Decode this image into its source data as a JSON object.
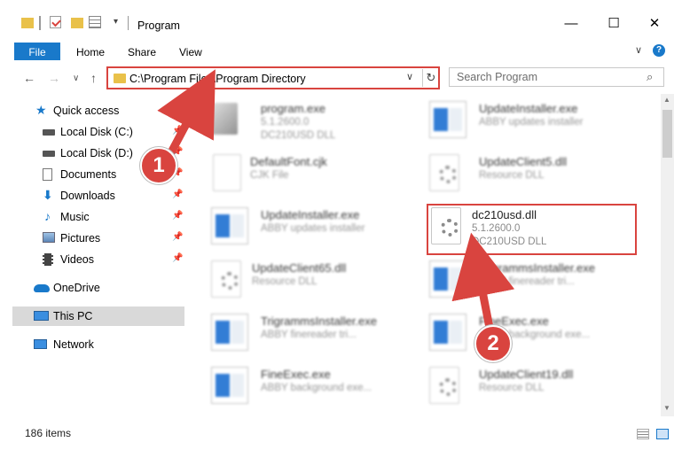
{
  "window": {
    "title": "Program",
    "controls": {
      "minimize": "—",
      "maximize": "☐",
      "close": "✕"
    }
  },
  "ribbon": {
    "file": "File",
    "home": "Home",
    "share": "Share",
    "view": "View",
    "collapse": "∨",
    "help": "?"
  },
  "address": {
    "path": "C:\\Program Files\\Program Directory",
    "dropdown": "∨",
    "refresh": "↻"
  },
  "search": {
    "placeholder": "Search Program"
  },
  "nav": {
    "back": "←",
    "forward": "→",
    "recent": "∨",
    "up": "↑",
    "items": [
      {
        "label": "Quick access",
        "icon": "star-icon",
        "pinned": false
      },
      {
        "label": "Local Disk (C:)",
        "icon": "drive-icon",
        "pinned": true
      },
      {
        "label": "Local Disk (D:)",
        "icon": "drive-icon",
        "pinned": true
      },
      {
        "label": "Documents",
        "icon": "documents-icon",
        "pinned": true
      },
      {
        "label": "Downloads",
        "icon": "download-icon",
        "pinned": true
      },
      {
        "label": "Music",
        "icon": "music-icon",
        "pinned": true
      },
      {
        "label": "Pictures",
        "icon": "pictures-icon",
        "pinned": true
      },
      {
        "label": "Videos",
        "icon": "videos-icon",
        "pinned": true
      },
      {
        "label": "OneDrive",
        "icon": "cloud-icon"
      },
      {
        "label": "This PC",
        "icon": "computer-icon"
      },
      {
        "label": "Network",
        "icon": "network-icon"
      }
    ]
  },
  "files": [
    {
      "name": "program.exe",
      "line1": "5.1.2600.0",
      "line2": "DC210USD DLL",
      "type": "exe"
    },
    {
      "name": "UpdateInstaller.exe",
      "line1": "ABBY updates installer",
      "line2": "",
      "type": "app"
    },
    {
      "name": "DefaultFont.cjk",
      "line1": "CJK File",
      "line2": "",
      "type": "doc"
    },
    {
      "name": "UpdateClient5.dll",
      "line1": "Resource DLL",
      "line2": "",
      "type": "dll"
    },
    {
      "name": "UpdateInstaller.exe",
      "line1": "ABBY updates installer",
      "line2": "",
      "type": "app"
    },
    {
      "name": "dc210usd.dll",
      "line1": "5.1.2600.0",
      "line2": "DC210USD DLL",
      "type": "dll"
    },
    {
      "name": "UpdateClient65.dll",
      "line1": "Resource DLL",
      "line2": "",
      "type": "dll"
    },
    {
      "name": "TrigrammsInstaller.exe",
      "line1": "ABBY finereader tri...",
      "line2": "",
      "type": "app"
    },
    {
      "name": "TrigrammsInstaller.exe",
      "line1": "ABBY finereader tri...",
      "line2": "",
      "type": "app"
    },
    {
      "name": "FineExec.exe",
      "line1": "ABBY background exe...",
      "line2": "",
      "type": "app"
    },
    {
      "name": "FineExec.exe",
      "line1": "ABBY background exe...",
      "line2": "",
      "type": "app"
    },
    {
      "name": "UpdateClient19.dll",
      "line1": "Resource DLL",
      "line2": "",
      "type": "dll"
    }
  ],
  "status": {
    "count": "186 items"
  },
  "callouts": [
    "1",
    "2"
  ],
  "colors": {
    "accent": "#1979ca",
    "highlight": "#d9443f",
    "folder": "#e9c14a"
  }
}
